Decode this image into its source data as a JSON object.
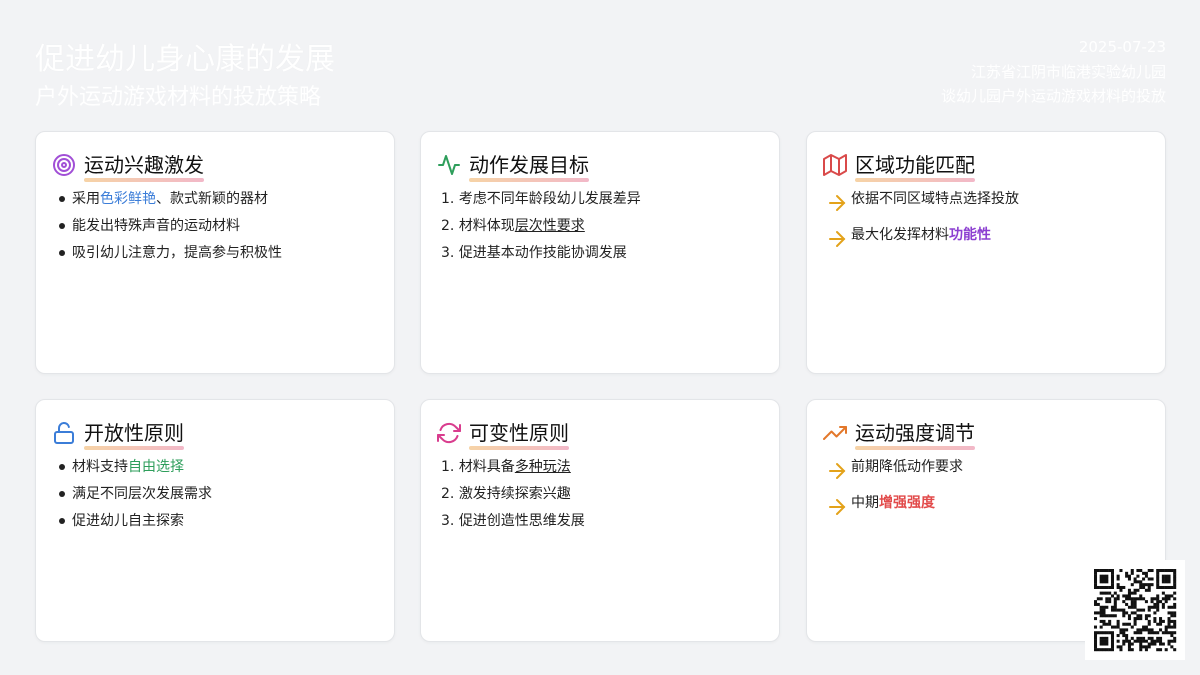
{
  "header": {
    "title": "促进幼儿身心康的发展",
    "subtitle": "户外运动游戏材料的投放策略",
    "date": "2025-07-23",
    "org": "江苏省江阴市临港实验幼儿园",
    "topic": "谈幼儿园户外运动游戏材料的投放"
  },
  "cards": [
    {
      "title": "运动兴趣激发",
      "icon": "target-icon",
      "items": [
        {
          "pre": "采用",
          "hl": "色彩鲜艳",
          "post": "、款式新颖的器材"
        },
        {
          "pre": "能发出特殊声音的运动材料",
          "hl": "",
          "post": ""
        },
        {
          "pre": "吸引幼儿注意力，提高参与积极性",
          "hl": "",
          "post": ""
        }
      ]
    },
    {
      "title": "动作发展目标",
      "icon": "activity-icon",
      "items": [
        {
          "num": "1.",
          "pre": "考虑不同年龄段幼儿发展差异",
          "hl": "",
          "post": ""
        },
        {
          "num": "2.",
          "pre": "材料体现",
          "hl": "层次性要求",
          "post": ""
        },
        {
          "num": "3.",
          "pre": "促进基本动作技能协调发展",
          "hl": "",
          "post": ""
        }
      ]
    },
    {
      "title": "区域功能匹配",
      "icon": "map-icon",
      "items": [
        {
          "pre": "依据不同区域特点选择投放",
          "hl": "",
          "post": ""
        },
        {
          "pre": "最大化发挥材料",
          "hl": "功能性",
          "post": ""
        }
      ]
    },
    {
      "title": "开放性原则",
      "icon": "unlock-icon",
      "items": [
        {
          "pre": "材料支持",
          "hl": "自由选择",
          "post": ""
        },
        {
          "pre": "满足不同层次发展需求",
          "hl": "",
          "post": ""
        },
        {
          "pre": "促进幼儿自主探索",
          "hl": "",
          "post": ""
        }
      ]
    },
    {
      "title": "可变性原则",
      "icon": "refresh-icon",
      "items": [
        {
          "num": "1.",
          "pre": "材料具备",
          "hl": "多种玩法",
          "post": ""
        },
        {
          "num": "2.",
          "pre": "激发持续探索兴趣",
          "hl": "",
          "post": ""
        },
        {
          "num": "3.",
          "pre": "促进创造性思维发展",
          "hl": "",
          "post": ""
        }
      ]
    },
    {
      "title": "运动强度调节",
      "icon": "trending-up-icon",
      "items": [
        {
          "pre": "前期降低动作要求",
          "hl": "",
          "post": ""
        },
        {
          "pre": "中期",
          "hl": "增强强度",
          "post": ""
        }
      ]
    }
  ],
  "colors": {
    "target": "#a14fd6",
    "activity": "#2e9e5b",
    "map": "#d94a4a",
    "unlock": "#3b7dd8",
    "refresh": "#d93d8e",
    "trend": "#e3782b",
    "arrow": "#e3a21a"
  }
}
